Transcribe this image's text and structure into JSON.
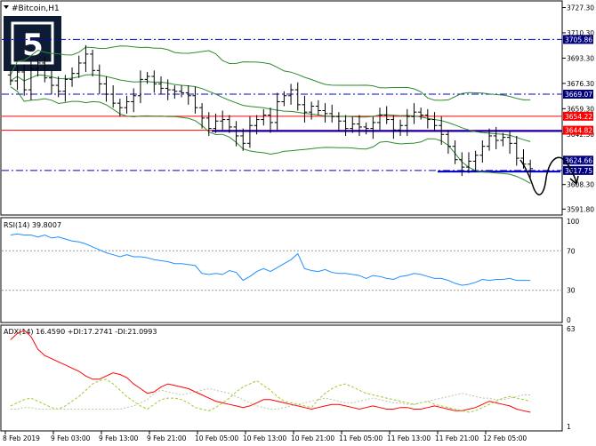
{
  "header": {
    "symbol_label": "#Bitcoin,H1",
    "rsi_label": "RSI(14) 39.8007",
    "adx_label": "ADX(14) 16.4590 +DI:17.2741 -DI:21.0993"
  },
  "logo": {
    "glyph": "5"
  },
  "colors": {
    "background": "#ffffff",
    "candle": "#000000",
    "bands": "#2e8b2e",
    "red_level": "#ff0000",
    "blue_level": "#0000cc",
    "rsi": "#1e90ff",
    "adx": "#ff0000",
    "plus_di": "#9acd32",
    "minus_di": "#b8c8a0",
    "frame": "#000080"
  },
  "chart_data": [
    {
      "type": "candlestick",
      "title": "#Bitcoin,H1",
      "ylim": [
        3589,
        3730
      ],
      "y_ticks": [
        "3727.30",
        "3710.30",
        "3693.30",
        "3676.30",
        "3659.30",
        "3642.30",
        "3608.30",
        "3591.80"
      ],
      "x_ticks": [
        "8 Feb 2019",
        "9 Feb 03:00",
        "9 Feb 13:00",
        "9 Feb 21:00",
        "10 Feb 05:00",
        "10 Feb 13:00",
        "10 Feb 21:00",
        "11 Feb 05:00",
        "11 Feb 13:00",
        "11 Feb 21:00",
        "12 Feb 05:00"
      ],
      "levels": [
        {
          "value": "3705.86",
          "style": "dash-dot",
          "color": "#0000cc"
        },
        {
          "value": "3669.07",
          "style": "dash-dot",
          "color": "#0000cc"
        },
        {
          "value": "3654.22",
          "style": "solid",
          "color": "#ff0000"
        },
        {
          "value": "3644.82",
          "style": "solid",
          "color": "#ff0000"
        },
        {
          "value": "3624.66",
          "style": "label",
          "color": "#000080"
        },
        {
          "value": "3617.75",
          "style": "dash-dot",
          "color": "#0000cc"
        }
      ],
      "close": [
        3678,
        3684,
        3672,
        3686,
        3690,
        3680,
        3675,
        3671,
        3679,
        3683,
        3690,
        3696,
        3685,
        3676,
        3669,
        3663,
        3660,
        3664,
        3668,
        3679,
        3681,
        3676,
        3673,
        3672,
        3671,
        3670,
        3668,
        3660,
        3653,
        3646,
        3651,
        3652,
        3647,
        3641,
        3636,
        3648,
        3652,
        3655,
        3650,
        3664,
        3668,
        3672,
        3662,
        3657,
        3661,
        3658,
        3656,
        3654,
        3651,
        3646,
        3649,
        3647,
        3646,
        3650,
        3655,
        3652,
        3645,
        3648,
        3654,
        3657,
        3655,
        3652,
        3648,
        3642,
        3634,
        3625,
        3620,
        3624,
        3628,
        3634,
        3641,
        3638,
        3640,
        3636,
        3626,
        3622,
        3619
      ]
    },
    {
      "type": "line",
      "title": "RSI(14) 39.8007",
      "ylim": [
        0,
        100
      ],
      "y_ticks": [
        "100",
        "70",
        "30",
        "0"
      ],
      "levels": [
        70,
        30
      ],
      "values": [
        86,
        87,
        86,
        86,
        84,
        86,
        83,
        84,
        82,
        80,
        79,
        77,
        74,
        71,
        68,
        66,
        64,
        66,
        64,
        64,
        63,
        61,
        60,
        59,
        57,
        57,
        56,
        55,
        47,
        46,
        47,
        46,
        50,
        48,
        40,
        44,
        49,
        52,
        49,
        53,
        57,
        61,
        67,
        52,
        50,
        49,
        51,
        48,
        47,
        47,
        46,
        45,
        42,
        45,
        44,
        42,
        41,
        44,
        45,
        47,
        46,
        44,
        42,
        42,
        40,
        37,
        35,
        36,
        38,
        41,
        40,
        41,
        41,
        42,
        40,
        40,
        40
      ]
    },
    {
      "type": "line",
      "title": "ADX(14) 16.4590 +DI:17.2741 -DI:21.0993",
      "ylim": [
        1,
        63
      ],
      "y_ticks": [
        "63",
        "1"
      ],
      "series": [
        {
          "name": "ADX",
          "values": [
            56,
            60,
            62,
            58,
            50,
            46,
            44,
            42,
            40,
            38,
            36,
            33,
            31,
            31,
            33,
            35,
            34,
            32,
            28,
            25,
            22,
            23,
            26,
            28,
            27,
            26,
            25,
            23,
            21,
            19,
            17,
            16,
            15,
            14,
            13,
            14,
            16,
            18,
            18,
            17,
            16,
            15,
            14,
            13,
            12,
            13,
            14,
            15,
            15,
            14,
            13,
            12,
            13,
            14,
            13,
            12,
            12,
            13,
            13,
            12,
            12,
            13,
            14,
            13,
            12,
            11,
            11,
            12,
            13,
            15,
            17,
            16,
            15,
            14,
            12,
            11,
            10
          ]
        },
        {
          "name": "+DI",
          "values": [
            14,
            16,
            18,
            19,
            17,
            15,
            13,
            12,
            14,
            17,
            20,
            24,
            28,
            30,
            31,
            28,
            24,
            20,
            17,
            14,
            12,
            15,
            18,
            19,
            19,
            18,
            16,
            13,
            12,
            11,
            13,
            16,
            19,
            23,
            26,
            28,
            30,
            27,
            24,
            20,
            17,
            16,
            15,
            14,
            13,
            18,
            22,
            25,
            27,
            28,
            26,
            24,
            22,
            21,
            20,
            19,
            18,
            17,
            16,
            15,
            16,
            17,
            15,
            14,
            13,
            12,
            11,
            10,
            11,
            13,
            15,
            17,
            19,
            20,
            19,
            18,
            17
          ]
        },
        {
          "name": "-DI",
          "values": [
            12,
            12,
            13,
            13,
            12,
            12,
            12,
            12,
            12,
            12,
            12,
            12,
            12,
            12,
            12,
            12,
            12,
            13,
            14,
            16,
            18,
            22,
            24,
            23,
            22,
            21,
            22,
            23,
            24,
            25,
            24,
            23,
            22,
            20,
            18,
            16,
            14,
            13,
            12,
            12,
            13,
            14,
            15,
            16,
            17,
            18,
            19,
            18,
            17,
            16,
            16,
            17,
            18,
            19,
            18,
            17,
            16,
            16,
            15,
            15,
            16,
            17,
            18,
            19,
            20,
            21,
            22,
            21,
            20,
            19,
            19,
            18,
            18,
            19,
            20,
            21,
            21
          ]
        }
      ]
    }
  ]
}
